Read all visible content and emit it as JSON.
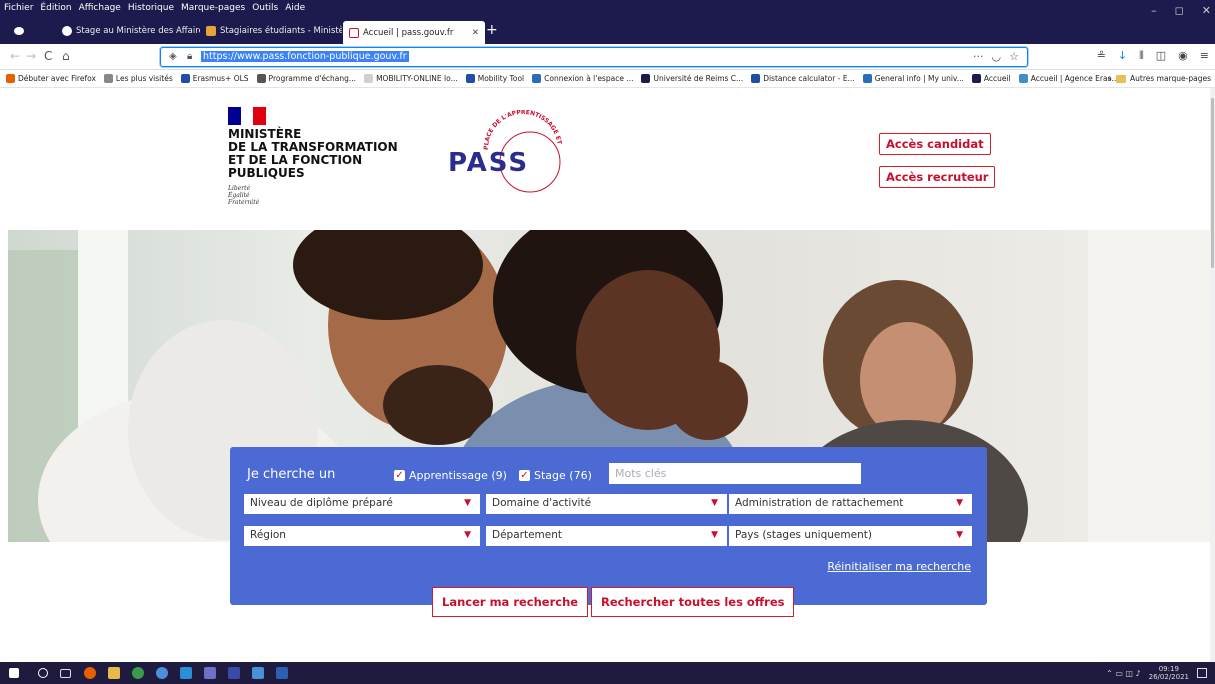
{
  "menubar": {
    "items": [
      "Fichier",
      "Édition",
      "Affichage",
      "Historique",
      "Marque-pages",
      "Outils",
      "Aide"
    ]
  },
  "window": {
    "minimize": "–",
    "maximize": "◻",
    "close": "✕"
  },
  "tabs": [
    {
      "label": "Stage au Ministère des Affaires",
      "close": "✕"
    },
    {
      "label": "Stagiaires étudiants - Ministère",
      "close": "✕"
    },
    {
      "label": "Accueil | pass.gouv.fr",
      "close": "✕"
    }
  ],
  "new_tab": "+",
  "nav": {
    "back": "←",
    "forward": "→",
    "reload": "C",
    "home": "⌂"
  },
  "url": "https://www.pass.fonction-publique.gouv.fr",
  "urlbar_icons": {
    "more": "···",
    "pocket": "◡",
    "star": "☆"
  },
  "toolbar_icons": [
    "≗",
    "↓",
    "⫴",
    "◫",
    "◉",
    "≡"
  ],
  "bookmarks": [
    {
      "label": "Débuter avec Firefox",
      "color": "#e66000"
    },
    {
      "label": "Les plus visités",
      "color": "#888888"
    },
    {
      "label": "Erasmus+ OLS",
      "color": "#1f4fa3"
    },
    {
      "label": "Programme d'échang...",
      "color": "#555555"
    },
    {
      "label": "MOBILITY-ONLINE lo...",
      "color": "#d0d0d0"
    },
    {
      "label": "Mobility Tool",
      "color": "#1f4fa3"
    },
    {
      "label": "Connexion à l'espace ...",
      "color": "#2a6ebb"
    },
    {
      "label": "Université de Reims C...",
      "color": "#1d1a4d"
    },
    {
      "label": "Distance calculator - E...",
      "color": "#1f4fa3"
    },
    {
      "label": "General info | My univ...",
      "color": "#2a6ebb"
    },
    {
      "label": "Accueil",
      "color": "#1d1a4d"
    },
    {
      "label": "Accueil | Agence Eras...",
      "color": "#3d8ec9"
    }
  ],
  "bookmarks_right": {
    "chevron": "»",
    "label": "Autres marque-pages"
  },
  "header": {
    "ministry": [
      "MINISTÈRE",
      "DE LA TRANSFORMATION",
      "ET DE LA FONCTION",
      "PUBLIQUES"
    ],
    "motto": [
      "Liberté",
      "Égalité",
      "Fraternité"
    ],
    "logo_text": "PASS",
    "logo_arc_text": "PLACE DE L'APPRENTISSAGE ET DES STAGES",
    "candidate_btn": "Accès candidat",
    "recruiter_btn": "Accès recruteur"
  },
  "search": {
    "label": "Je cherche un",
    "opt_apprentissage": "Apprentissage (9)",
    "opt_stage": "Stage (76)",
    "keywords_placeholder": "Mots clés",
    "niveau": "Niveau de diplôme préparé",
    "domaine": "Domaine d'activité",
    "administration": "Administration de rattachement",
    "region": "Région",
    "departement": "Département",
    "pays": "Pays (stages uniquement)",
    "reset": "Réinitialiser ma recherche",
    "launch": "Lancer ma recherche",
    "all_offers": "Rechercher toutes les offres"
  },
  "taskbar": {
    "time": "09:19",
    "date": "26/02/2021"
  },
  "colors": {
    "panel": "#4c6ad3",
    "accent_red": "#c8102e",
    "browser_dark": "#1d1a4d"
  }
}
